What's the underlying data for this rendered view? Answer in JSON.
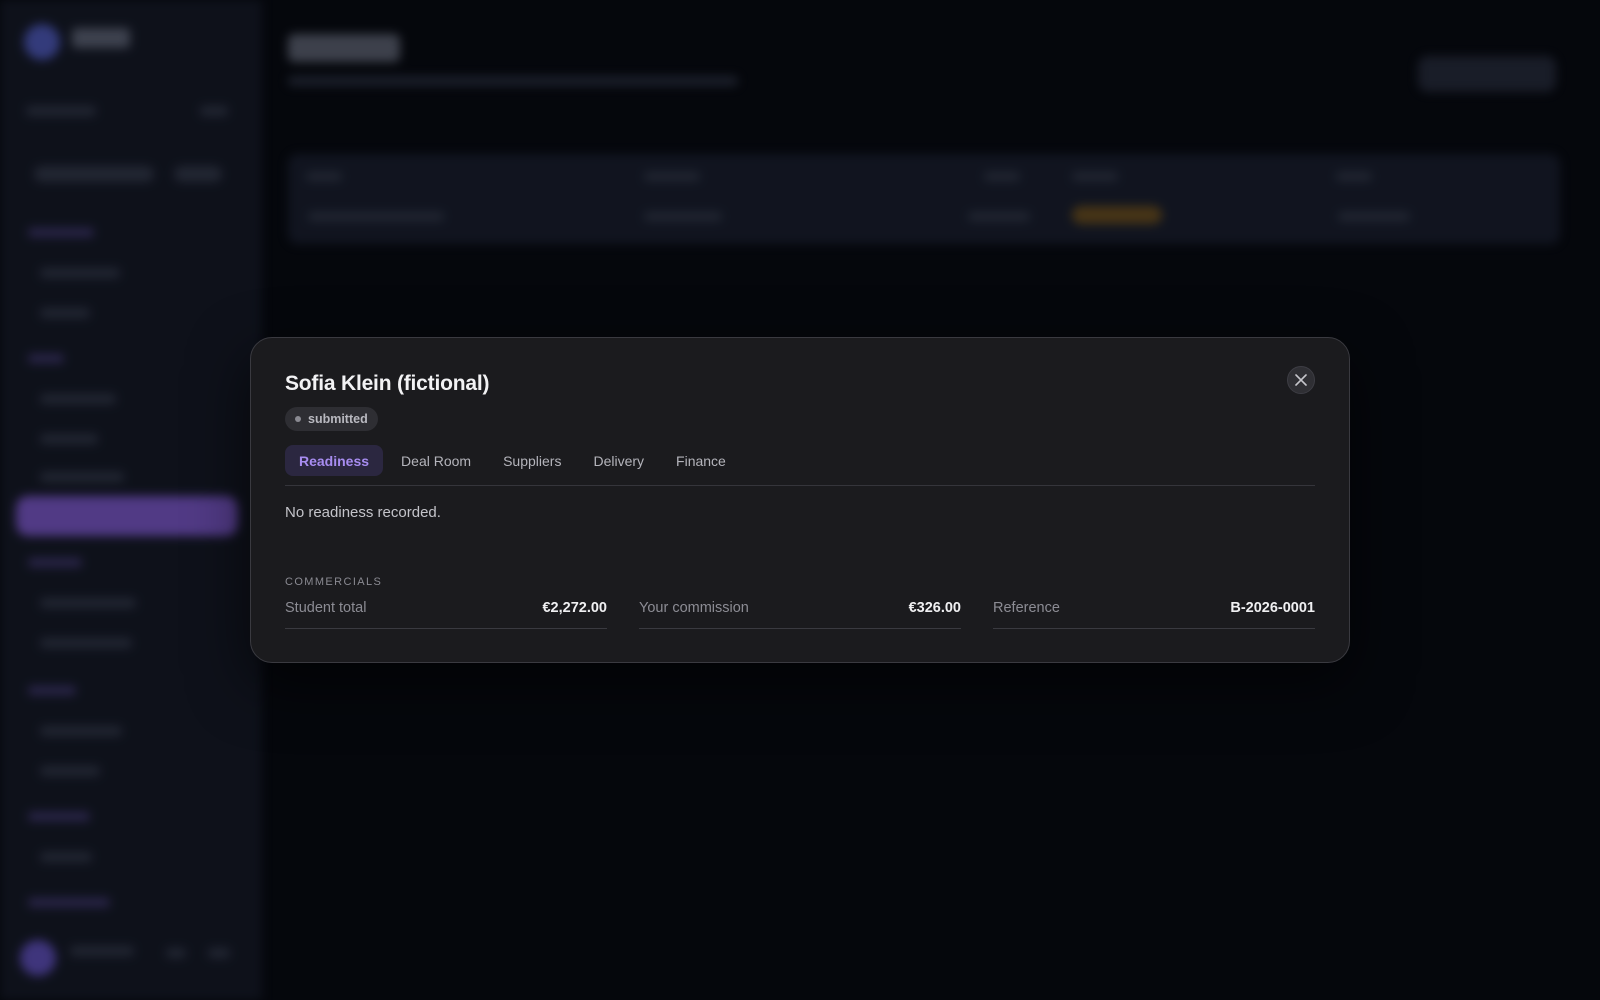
{
  "modal": {
    "title": "Sofia Klein (fictional)",
    "status": "submitted",
    "close_icon": "close-icon",
    "tabs": [
      {
        "label": "Readiness",
        "active": true
      },
      {
        "label": "Deal Room",
        "active": false
      },
      {
        "label": "Suppliers",
        "active": false
      },
      {
        "label": "Delivery",
        "active": false
      },
      {
        "label": "Finance",
        "active": false
      }
    ],
    "empty_message": "No readiness recorded.",
    "commercials": {
      "section_label": "COMMERCIALS",
      "items": [
        {
          "label": "Student total",
          "value": "€2,272.00"
        },
        {
          "label": "Your commission",
          "value": "€326.00"
        },
        {
          "label": "Reference",
          "value": "B-2026-0001"
        }
      ]
    }
  },
  "colors": {
    "accent": "#a78cf0",
    "active_tab_bg": "#2b2740",
    "modal_bg": "#1b1b1e",
    "sidebar_active": "#8f64e8",
    "status_warning": "#7d5a1f"
  }
}
